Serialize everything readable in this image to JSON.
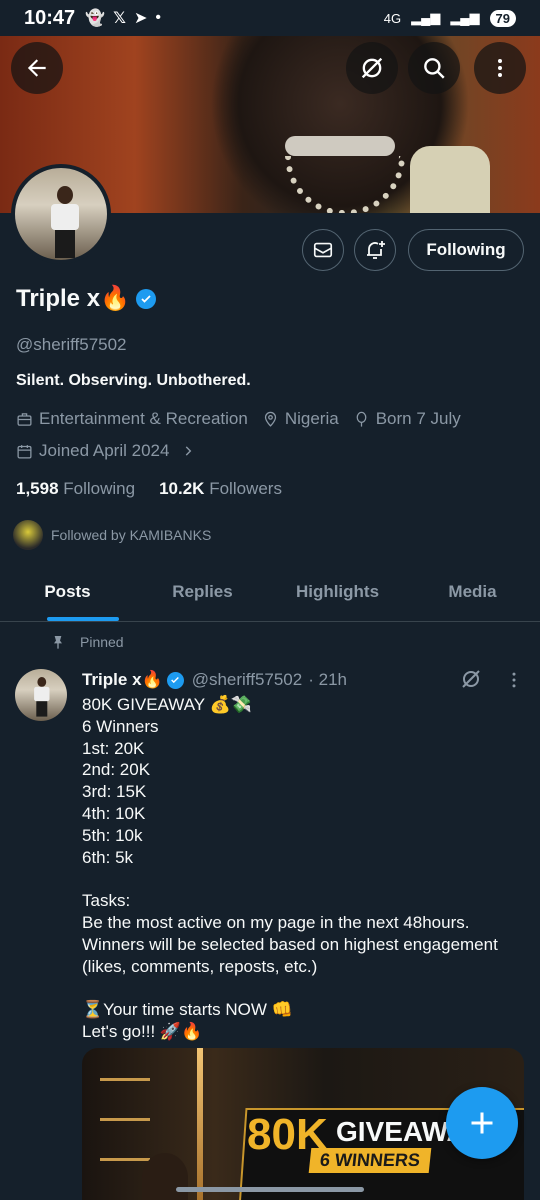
{
  "status_bar": {
    "time": "10:47",
    "network": "4G",
    "battery": "79"
  },
  "profile": {
    "name": "Triple x🔥",
    "handle": "@sheriff57502",
    "bio": "Silent. Observing. Unbothered.",
    "category": "Entertainment & Recreation",
    "location": "Nigeria",
    "birthday": "Born 7 July",
    "joined": "Joined April 2024",
    "following_count": "1,598",
    "following_label": "Following",
    "followers_count": "10.2K",
    "followers_label": "Followers",
    "followed_by": "Followed by KAMIBANKS",
    "follow_button_label": "Following"
  },
  "tabs": [
    {
      "label": "Posts",
      "active": true
    },
    {
      "label": "Replies",
      "active": false
    },
    {
      "label": "Highlights",
      "active": false
    },
    {
      "label": "Media",
      "active": false
    }
  ],
  "post": {
    "pinned_label": "Pinned",
    "author_name": "Triple x🔥",
    "author_handle": "@sheriff57502",
    "time": "· 21h",
    "lines": [
      "80K GIVEAWAY 💰💸",
      "6 Winners",
      "1st: 20K",
      "2nd: 20K",
      "3rd: 15K",
      "4th: 10K",
      "5th: 10k",
      "6th: 5k",
      "",
      "Tasks:",
      "Be the most active on my page in the next 48hours.",
      "Winners will be selected based on highest engagement",
      "(likes, comments, reposts, etc.)",
      "",
      "⏳Your time starts NOW 👊",
      "Let's go!!! 🚀🔥"
    ],
    "media": {
      "amount": "80K",
      "title": "GIVEAWAY",
      "subtitle": "6 WINNERS"
    }
  },
  "colors": {
    "background": "#15202b",
    "accent": "#1d9bf0",
    "secondary_text": "#8b98a5",
    "border": "#536471"
  },
  "icons": {
    "back": "arrow-left-icon",
    "grok": "grok-icon",
    "search": "search-icon",
    "more": "more-vertical-icon",
    "message": "envelope-icon",
    "notify": "bell-plus-icon",
    "category": "briefcase-icon",
    "location": "location-pin-icon",
    "birthday": "balloon-icon",
    "joined": "calendar-icon",
    "pin": "pin-icon",
    "compose": "plus-icon"
  }
}
